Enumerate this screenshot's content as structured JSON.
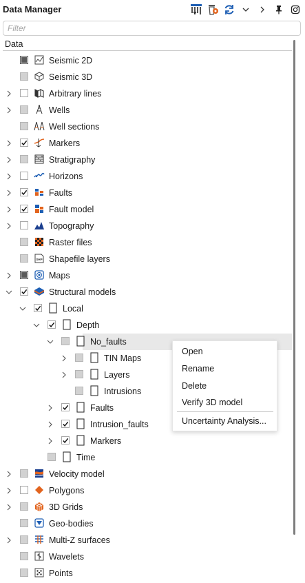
{
  "title": "Data Manager",
  "filter": {
    "placeholder": "Filter"
  },
  "header": {
    "column": "Data"
  },
  "tree": [
    {
      "level": 0,
      "label": "Seismic 2D",
      "icon": "seismic-2d-icon",
      "check": "partial-dark",
      "expander": "none"
    },
    {
      "level": 0,
      "label": "Seismic 3D",
      "icon": "seismic-3d-icon",
      "check": "partial",
      "expander": "none"
    },
    {
      "level": 0,
      "label": "Arbitrary lines",
      "icon": "arbitrary-lines-icon",
      "check": "unchecked",
      "expander": "collapsed"
    },
    {
      "level": 0,
      "label": "Wells",
      "icon": "wells-icon",
      "check": "partial",
      "expander": "collapsed"
    },
    {
      "level": 0,
      "label": "Well sections",
      "icon": "well-sections-icon",
      "check": "partial",
      "expander": "none"
    },
    {
      "level": 0,
      "label": "Markers",
      "icon": "markers-icon",
      "check": "checked",
      "expander": "collapsed"
    },
    {
      "level": 0,
      "label": "Stratigraphy",
      "icon": "stratigraphy-icon",
      "check": "partial",
      "expander": "collapsed"
    },
    {
      "level": 0,
      "label": "Horizons",
      "icon": "horizons-icon",
      "check": "unchecked",
      "expander": "collapsed"
    },
    {
      "level": 0,
      "label": "Faults",
      "icon": "faults-icon",
      "check": "checked",
      "expander": "collapsed"
    },
    {
      "level": 0,
      "label": "Fault model",
      "icon": "fault-model-icon",
      "check": "checked",
      "expander": "collapsed"
    },
    {
      "level": 0,
      "label": "Topography",
      "icon": "topography-icon",
      "check": "unchecked",
      "expander": "collapsed"
    },
    {
      "level": 0,
      "label": "Raster files",
      "icon": "raster-files-icon",
      "check": "partial",
      "expander": "none"
    },
    {
      "level": 0,
      "label": "Shapefile layers",
      "icon": "shapefile-icon",
      "check": "partial",
      "expander": "none"
    },
    {
      "level": 0,
      "label": "Maps",
      "icon": "maps-icon",
      "check": "partial-dark",
      "expander": "collapsed"
    },
    {
      "level": 0,
      "label": "Structural models",
      "icon": "structural-models-icon",
      "check": "checked",
      "expander": "expanded"
    },
    {
      "level": 1,
      "label": "Local",
      "icon": "folder-icon",
      "check": "checked",
      "expander": "expanded"
    },
    {
      "level": 2,
      "label": "Depth",
      "icon": "folder-icon",
      "check": "checked",
      "expander": "expanded"
    },
    {
      "level": 3,
      "label": "No_faults",
      "icon": "model-icon",
      "check": "partial",
      "expander": "expanded",
      "selected": true
    },
    {
      "level": 4,
      "label": "TIN Maps",
      "icon": "folder-icon",
      "check": "partial",
      "expander": "collapsed"
    },
    {
      "level": 4,
      "label": "Layers",
      "icon": "folder-icon",
      "check": "partial",
      "expander": "collapsed"
    },
    {
      "level": 4,
      "label": "Intrusions",
      "icon": "folder-icon",
      "check": "partial",
      "expander": "none"
    },
    {
      "level": 3,
      "label": "Faults",
      "icon": "folder-icon",
      "check": "checked",
      "expander": "collapsed"
    },
    {
      "level": 3,
      "label": "Intrusion_faults",
      "icon": "folder-icon",
      "check": "checked",
      "expander": "collapsed"
    },
    {
      "level": 3,
      "label": "Markers",
      "icon": "folder-icon",
      "check": "checked",
      "expander": "collapsed"
    },
    {
      "level": 2,
      "label": "Time",
      "icon": "folder-icon",
      "check": "partial",
      "expander": "none"
    },
    {
      "level": 0,
      "label": "Velocity model",
      "icon": "velocity-model-icon",
      "check": "partial",
      "expander": "collapsed"
    },
    {
      "level": 0,
      "label": "Polygons",
      "icon": "polygons-icon",
      "check": "unchecked",
      "expander": "collapsed"
    },
    {
      "level": 0,
      "label": "3D Grids",
      "icon": "3d-grids-icon",
      "check": "partial",
      "expander": "collapsed"
    },
    {
      "level": 0,
      "label": "Geo-bodies",
      "icon": "geo-bodies-icon",
      "check": "partial",
      "expander": "none"
    },
    {
      "level": 0,
      "label": "Multi-Z surfaces",
      "icon": "multi-z-surfaces-icon",
      "check": "partial",
      "expander": "collapsed"
    },
    {
      "level": 0,
      "label": "Wavelets",
      "icon": "wavelets-icon",
      "check": "partial",
      "expander": "none"
    },
    {
      "level": 0,
      "label": "Points",
      "icon": "points-icon",
      "check": "partial",
      "expander": "none"
    }
  ],
  "context_menu": {
    "items": [
      "Open",
      "Rename",
      "Delete",
      "Verify 3D model",
      "Uncertainty Analysis..."
    ]
  },
  "colors": {
    "accent": "#1e5fb4",
    "orange": "#e2641e",
    "selected_row": "#e8e8e8"
  }
}
